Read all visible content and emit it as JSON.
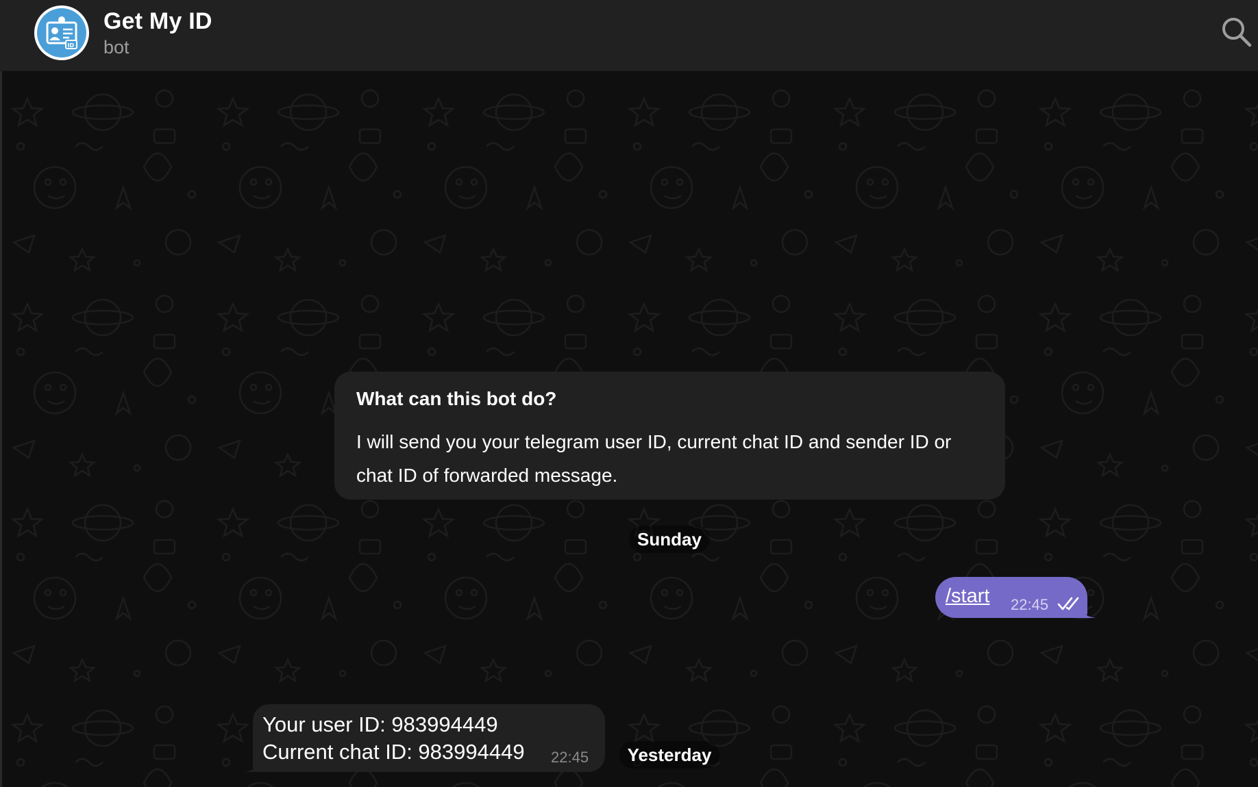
{
  "header": {
    "title": "Get My ID",
    "subtitle": "bot",
    "avatar_icon": "id-card-icon",
    "search_icon": "search-icon"
  },
  "bot_info": {
    "title": "What can this bot do?",
    "description": "I will send you your telegram user ID, current chat ID and sender ID or chat ID of forwarded message."
  },
  "dates": {
    "sunday": "Sunday",
    "yesterday": "Yesterday"
  },
  "messages": {
    "outgoing": {
      "text": "/start",
      "time": "22:45",
      "status": "read"
    },
    "incoming": {
      "line1": "Your user ID: 983994449",
      "line2": "Current chat ID: 983994449",
      "time": "22:45"
    }
  },
  "colors": {
    "outgoing_bubble": "#766ac8",
    "incoming_bubble": "#212121",
    "header_bg": "#212121",
    "avatar_bg": "#4a9fd8"
  }
}
